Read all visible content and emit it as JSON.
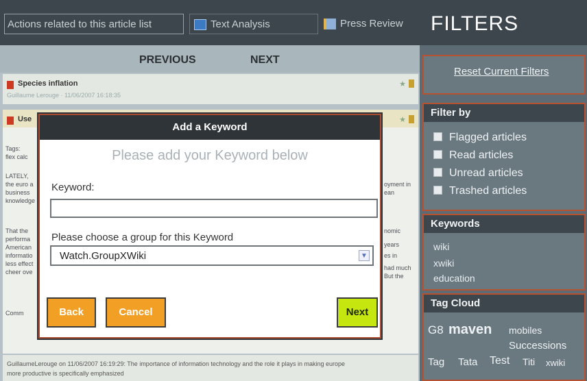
{
  "toolbar": {
    "actions_label": "Actions related to this article list",
    "text_analysis_label": "Text Analysis",
    "press_review_label": "Press Review"
  },
  "pager": {
    "previous": "PREVIOUS",
    "next": "NEXT"
  },
  "articles": [
    {
      "title": "Species inflation",
      "meta": "Guillaume Lerouge · 11/06/2007 16:18:35"
    },
    {
      "title": "Use"
    }
  ],
  "article_body": {
    "lines_left": [
      "Tags:",
      "flex calc",
      "LATELY,",
      "the euro a",
      "business",
      "knowledge",
      "That the",
      "performa",
      "American",
      "informatio",
      "less effect",
      "cheer ove"
    ],
    "lines_right": [
      "oyment in",
      "ean",
      "",
      "nomic",
      "years",
      "es in",
      "had much",
      "But the"
    ],
    "comments_label": "Comm"
  },
  "comment": {
    "author_line": "GuillaumeLerouge on 11/06/2007 16:19:29: The importance of information technology and the role it plays in making europe",
    "cont_line": "more productive is specifically emphasized"
  },
  "filters": {
    "title": "FILTERS",
    "reset_label": "Reset Current Filters",
    "filter_by": {
      "heading": "Filter by",
      "options": [
        "Flagged articles",
        "Read articles",
        "Unread articles",
        "Trashed articles"
      ]
    },
    "keywords": {
      "heading": "Keywords",
      "items": [
        "wiki",
        "xwiki",
        "education"
      ]
    },
    "tag_cloud": {
      "heading": "Tag Cloud",
      "tags": [
        "G8",
        "maven",
        "mobiles",
        "Successions",
        "Tag",
        "Tata",
        "Test",
        "Titi",
        "xwiki"
      ]
    }
  },
  "modal": {
    "title": "Add a Keyword",
    "subtitle": "Please add your Keyword below",
    "keyword_label": "Keyword:",
    "keyword_value": "",
    "group_label": "Please choose a group for this Keyword",
    "group_selected": "Watch.GroupXWiki",
    "back_label": "Back",
    "cancel_label": "Cancel",
    "next_label": "Next"
  },
  "colors": {
    "toolbar_bg": "#3d464c",
    "panel_border": "#b8512f",
    "button_orange": "#f2a025",
    "button_next": "#c6e60f"
  },
  "icons": {
    "text_analysis": "text-analysis-icon",
    "press_review": "press-review-icon",
    "select_arrow": "chevron-down-icon"
  }
}
